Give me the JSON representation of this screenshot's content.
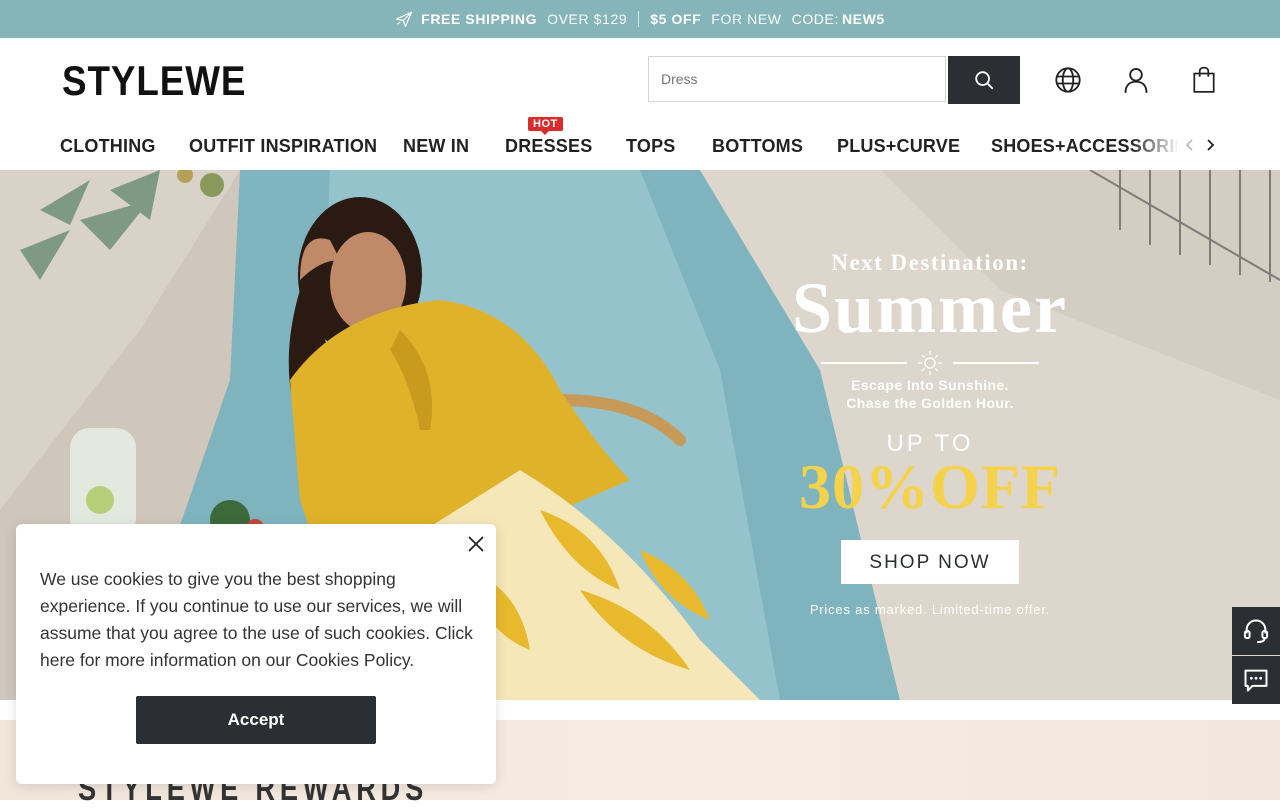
{
  "promo": {
    "free_shipping": "FREE SHIPPING",
    "over": "OVER $129",
    "off": "$5 OFF",
    "for_new": "FOR NEW",
    "code_label": "CODE:",
    "code": "NEW5"
  },
  "header": {
    "logo": "STYLEWE",
    "search_placeholder": "Dress"
  },
  "nav": {
    "items": [
      "CLOTHING",
      "OUTFIT INSPIRATION",
      "NEW IN",
      "DRESSES",
      "TOPS",
      "BOTTOMS",
      "PLUS+CURVE",
      "SHOES+ACCESSORIES"
    ],
    "hot_badge": "HOT"
  },
  "hero": {
    "line1": "Next Destination:",
    "line2": "Summer",
    "tagline1": "Escape Into Sunshine.",
    "tagline2": "Chase the Golden Hour.",
    "up_to": "UP TO",
    "discount": "30%OFF",
    "cta": "SHOP NOW",
    "note": "Prices as marked. Limited-time offer."
  },
  "rewards": {
    "title": "STYLEWE REWARDS"
  },
  "cookie": {
    "text": "We use cookies to give you the best shopping experience. If you continue to use our services, we will assume that you agree to the use of such cookies. Click here for more information on our Cookies Policy.",
    "accept": "Accept"
  },
  "colors": {
    "promo_bg": "#86b5b9",
    "dark": "#2b2f33",
    "hot_red": "#d92c2c",
    "discount_yellow": "#f4d24b"
  },
  "icons": [
    "plane-icon",
    "search-icon",
    "globe-icon",
    "user-icon",
    "bag-icon",
    "chevron-left-icon",
    "chevron-right-icon",
    "sun-icon",
    "support-headset-icon",
    "chat-icon",
    "close-icon"
  ]
}
